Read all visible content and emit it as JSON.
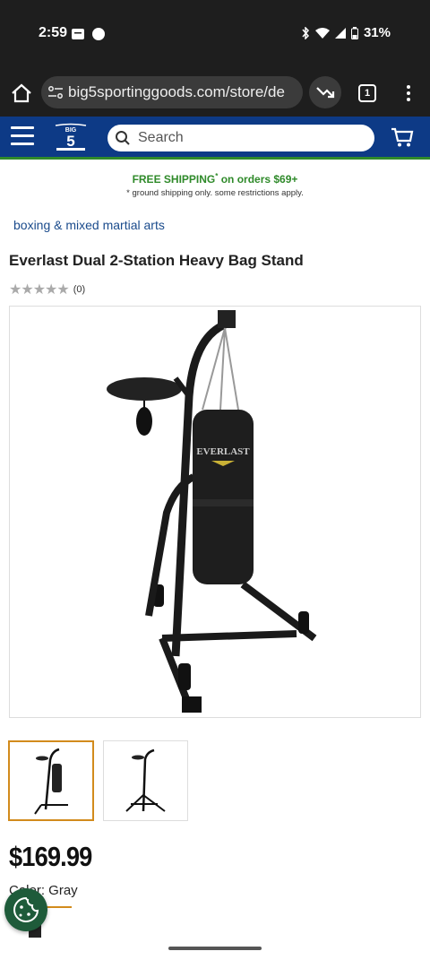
{
  "status_bar": {
    "time": "2:59",
    "battery": "31%"
  },
  "browser": {
    "url": "big5sportinggoods.com/store/de",
    "tab_count": "1"
  },
  "header": {
    "search_placeholder": "Search",
    "logo_text": "BIG 5"
  },
  "shipping": {
    "headline": "FREE SHIPPING",
    "headline_suffix": " on orders $69+",
    "note": "* ground shipping only. some restrictions apply."
  },
  "breadcrumb": "boxing & mixed martial arts",
  "product": {
    "title": "Everlast Dual 2-Station Heavy Bag Stand",
    "rating_stars": "★★★★★",
    "rating_count": "(0)",
    "price": "$169.99",
    "color_label": "Color: Gray"
  },
  "colors": {
    "header_blue": "#0d3a86",
    "accent_green": "#2f8a2a",
    "thumb_selected": "#d28b1c"
  }
}
